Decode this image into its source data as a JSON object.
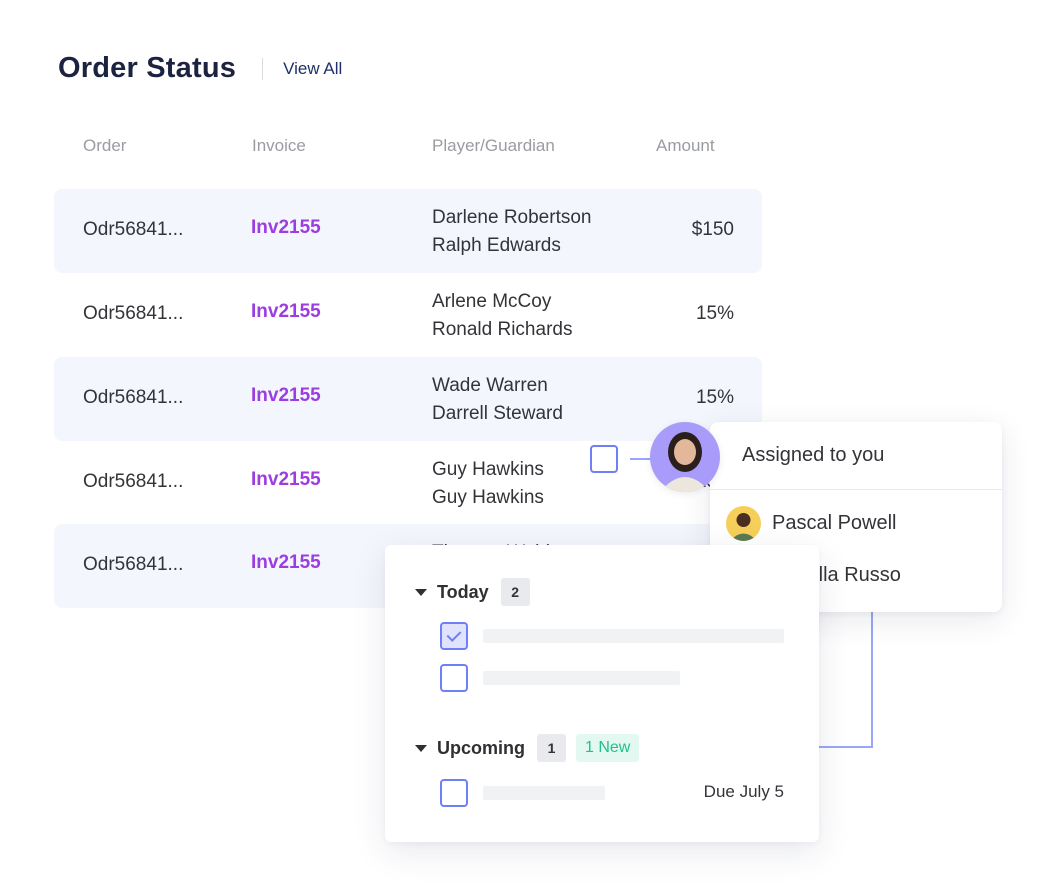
{
  "header": {
    "title": "Order Status",
    "view_all_label": "View All"
  },
  "table": {
    "columns": [
      "Order",
      "Invoice",
      "Player/Guardian",
      "Amount"
    ],
    "rows": [
      {
        "order": "Odr56841...",
        "invoice": "Inv2155",
        "player": "Darlene Robertson",
        "guardian": "Ralph Edwards",
        "amount": "$150"
      },
      {
        "order": "Odr56841...",
        "invoice": "Inv2155",
        "player": "Arlene McCoy",
        "guardian": "Ronald Richards",
        "amount": "15%"
      },
      {
        "order": "Odr56841...",
        "invoice": "Inv2155",
        "player": "Wade Warren",
        "guardian": "Darrell Steward",
        "amount": "15%"
      },
      {
        "order": "Odr56841...",
        "invoice": "Inv2155",
        "player": "Guy Hawkins",
        "guardian": "Guy Hawkins",
        "amount": "15%"
      },
      {
        "order": "Odr56841...",
        "invoice": "Inv2155",
        "player": "Theresa Webb",
        "guardian": "",
        "amount": ""
      }
    ]
  },
  "assign_popover": {
    "title": "Assigned to you",
    "assignees": [
      {
        "name": "Pascal Powell",
        "avatar_bg": "#f6cf5a"
      },
      {
        "name": "Camilla Russo",
        "avatar_bg": "#f4859a"
      }
    ],
    "current_user_avatar_bg": "#a99bf9"
  },
  "tasks": {
    "groups": [
      {
        "title": "Today",
        "count": "2",
        "badge": null,
        "items": [
          {
            "checked": true,
            "due": ""
          },
          {
            "checked": false,
            "due": ""
          }
        ]
      },
      {
        "title": "Upcoming",
        "count": "1",
        "badge": "1 New",
        "items": [
          {
            "checked": false,
            "due": "Due July 5"
          }
        ]
      }
    ]
  },
  "colors": {
    "title": "#1b2340",
    "invoice_link": "#9b3de0",
    "row_shade": "#f4f6fd",
    "accent": "#6f7ff5",
    "new_badge_text": "#22c08e",
    "new_badge_bg": "#e2f8f1"
  }
}
